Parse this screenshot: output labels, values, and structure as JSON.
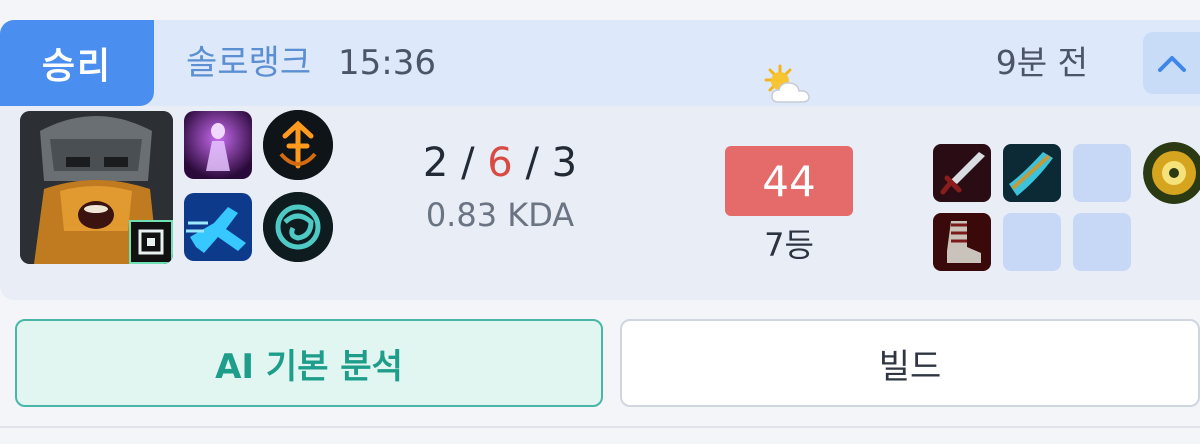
{
  "match": {
    "result": "승리",
    "queue": "솔로랭크",
    "duration": "15:36",
    "time_ago": "9분 전",
    "weather_icon": "partly-cloudy-icon",
    "expand_icon": "chevron-up-icon"
  },
  "stats": {
    "kills": "2",
    "deaths": "6",
    "assists": "3",
    "separator": "/",
    "kda_ratio": "0.83 KDA",
    "score": "44",
    "rank": "7등"
  },
  "buttons": {
    "ai_analysis": "AI 기본 분석",
    "build": "빌드"
  },
  "colors": {
    "win": "#4a8ef0",
    "deaths": "#d94a45",
    "score_bg": "#e56a6a",
    "ai_accent": "#1f9d8b"
  }
}
